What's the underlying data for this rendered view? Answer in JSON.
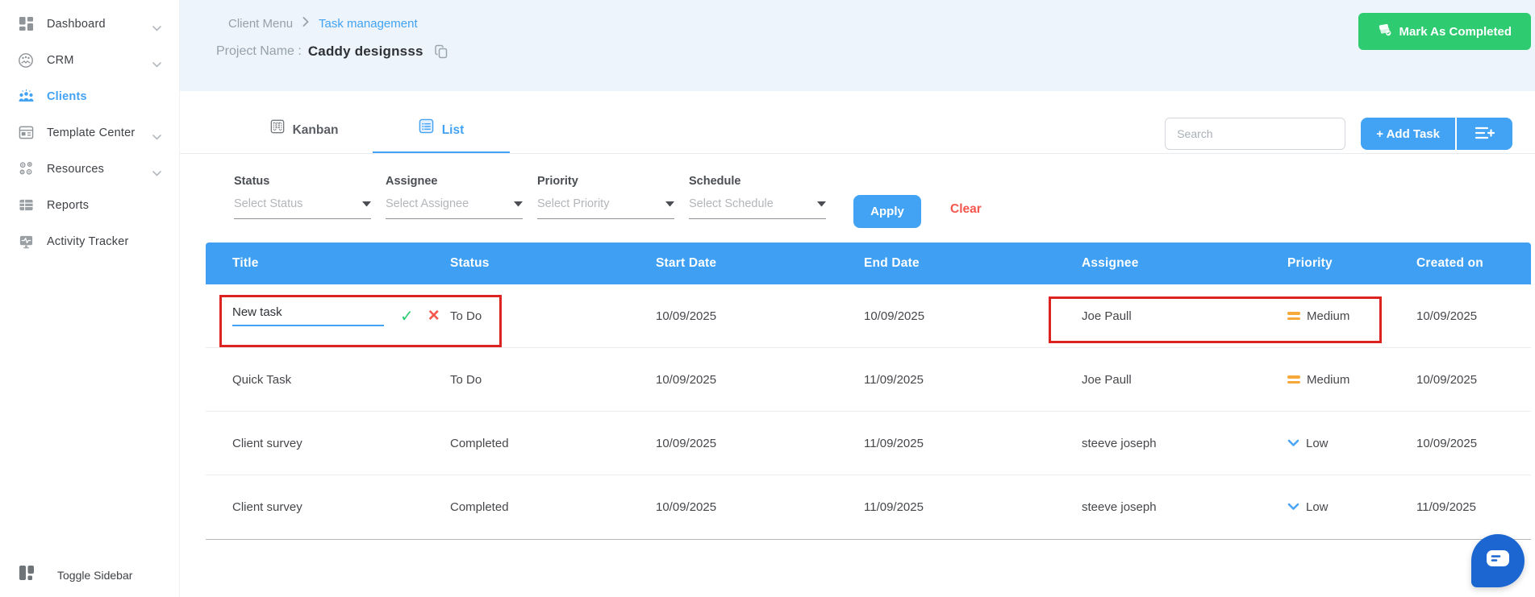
{
  "sidebar": {
    "items": [
      {
        "label": "Dashboard",
        "icon": "dashboard-icon",
        "expandable": true,
        "active": false
      },
      {
        "label": "CRM",
        "icon": "crm-icon",
        "expandable": true,
        "active": false
      },
      {
        "label": "Clients",
        "icon": "clients-icon",
        "expandable": false,
        "active": true
      },
      {
        "label": "Template Center",
        "icon": "template-center-icon",
        "expandable": true,
        "active": false
      },
      {
        "label": "Resources",
        "icon": "resources-icon",
        "expandable": true,
        "active": false
      },
      {
        "label": "Reports",
        "icon": "reports-icon",
        "expandable": false,
        "active": false
      },
      {
        "label": "Activity Tracker",
        "icon": "activity-tracker-icon",
        "expandable": false,
        "active": false
      }
    ],
    "toggle_label": "Toggle Sidebar"
  },
  "header": {
    "breadcrumb": {
      "parent": "Client Menu",
      "current": "Task management"
    },
    "project_label": "Project Name :",
    "project_name": "Caddy designsss",
    "mark_completed_label": "Mark As Completed"
  },
  "tabs": {
    "kanban": "Kanban",
    "list": "List",
    "active": "List"
  },
  "toolbar": {
    "search_placeholder": "Search",
    "add_task_label": "+ Add Task"
  },
  "filters": {
    "status_label": "Status",
    "status_placeholder": "Select Status",
    "assignee_label": "Assignee",
    "assignee_placeholder": "Select Assignee",
    "priority_label": "Priority",
    "priority_placeholder": "Select Priority",
    "schedule_label": "Schedule",
    "schedule_placeholder": "Select Schedule",
    "apply_label": "Apply",
    "clear_label": "Clear"
  },
  "table": {
    "columns": [
      "Title",
      "Status",
      "Start Date",
      "End Date",
      "Assignee",
      "Priority",
      "Created on"
    ],
    "edit_row": {
      "title_value": "New task",
      "status": "To Do",
      "start_date": "10/09/2025",
      "end_date": "10/09/2025",
      "assignee": "Joe Paull",
      "priority": "Medium",
      "created_on": "10/09/2025"
    },
    "rows": [
      {
        "title": "Quick Task",
        "status": "To Do",
        "start_date": "10/09/2025",
        "end_date": "11/09/2025",
        "assignee": "Joe Paull",
        "priority": "Medium",
        "created_on": "10/09/2025"
      },
      {
        "title": "Client survey",
        "status": "Completed",
        "start_date": "10/09/2025",
        "end_date": "11/09/2025",
        "assignee": "steeve joseph",
        "priority": "Low",
        "created_on": "10/09/2025"
      },
      {
        "title": "Client survey",
        "status": "Completed",
        "start_date": "10/09/2025",
        "end_date": "11/09/2025",
        "assignee": "steeve joseph",
        "priority": "Low",
        "created_on": "11/09/2025"
      }
    ]
  },
  "colors": {
    "accent_blue": "#42a3f4",
    "table_header_blue": "#3fa0f3",
    "success_green": "#2fcb70",
    "danger_red": "#f4574d",
    "annotation_red": "#dc2320",
    "medium_orange": "#f6a83b",
    "low_blue": "#4aa5f6",
    "chat_blue": "#1b66d1"
  }
}
